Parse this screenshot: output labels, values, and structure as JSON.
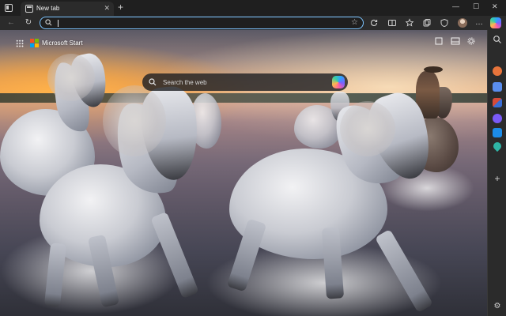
{
  "tabstrip": {
    "tab_title": "New tab",
    "tab_close": "✕",
    "new_tab": "+",
    "window_controls": [
      "—",
      "☐",
      "✕"
    ]
  },
  "toolbar": {
    "back": "←",
    "reload": "↻",
    "address_value": "",
    "favorite": "☆",
    "more": "…"
  },
  "ntp": {
    "brand": "Microsoft Start",
    "search_placeholder": "Search the web"
  },
  "sidebar": {
    "add": "+",
    "settings": "⚙",
    "items": [
      {
        "icon": "search-icon"
      },
      {
        "icon": "copilot-icon",
        "color": "#e8743b"
      },
      {
        "icon": "shopping-icon",
        "color": "#5a8dee"
      },
      {
        "icon": "office-icon",
        "color": "#d64b3a"
      },
      {
        "icon": "games-icon",
        "color": "#7a5af8"
      },
      {
        "icon": "outlook-icon",
        "color": "#1c8ce8"
      },
      {
        "icon": "drop-icon",
        "color": "#2fb5a6"
      }
    ]
  },
  "colors": {
    "address_focus": "#7cc4ff",
    "chrome_dark": "#2b2b2b",
    "tabstrip": "#1f1f1f"
  }
}
